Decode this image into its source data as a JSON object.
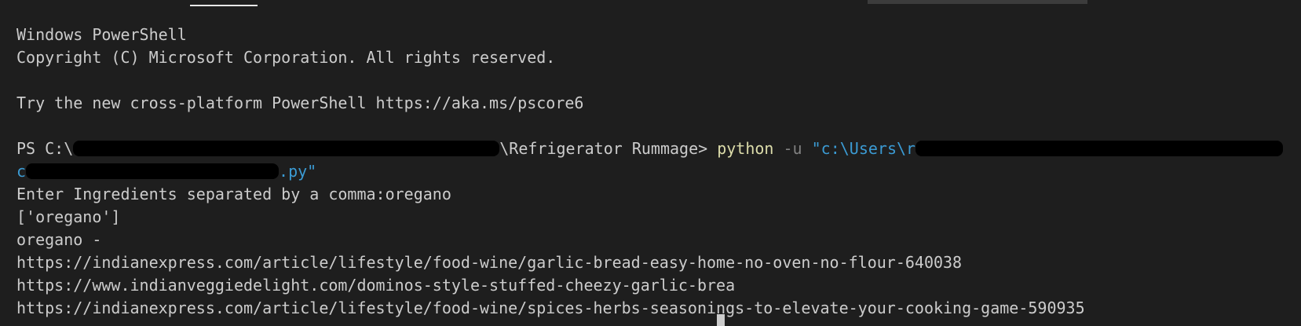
{
  "banner": {
    "title": "Windows PowerShell",
    "copyright": "Copyright (C) Microsoft Corporation. All rights reserved.",
    "tip": "Try the new cross-platform PowerShell https://aka.ms/pscore6"
  },
  "command": {
    "prompt_prefix": "PS C:\\",
    "prompt_suffix": "\\Refrigerator Rummage> ",
    "exe": "python",
    "flag": " -u ",
    "path_start": "\"c:\\Users\\r",
    "continuation_prefix": "c",
    "continuation_suffix": ".py\""
  },
  "output": {
    "line1": "Enter Ingredients separated by a comma:oregano",
    "line2": "['oregano']",
    "line3": "oregano -",
    "urls": [
      "https://indianexpress.com/article/lifestyle/food-wine/garlic-bread-easy-home-no-oven-no-flour-640038",
      "https://www.indianveggiedelight.com/dominos-style-stuffed-cheezy-garlic-brea",
      "https://indianexpress.com/article/lifestyle/food-wine/spices-herbs-seasonings-to-elevate-your-cooking-game-590935"
    ]
  }
}
